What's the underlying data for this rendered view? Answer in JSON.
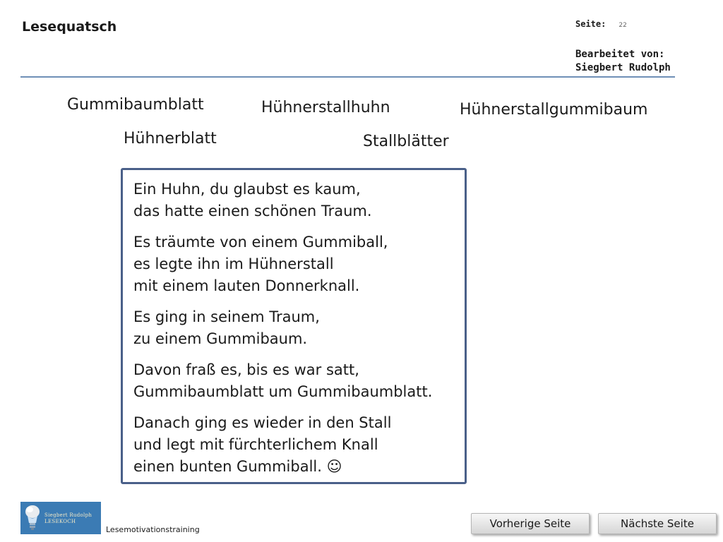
{
  "header": {
    "app_title": "Lesequatsch",
    "page_label": "Seite:",
    "page_number": "22",
    "edited_by_label": "Bearbeitet von:",
    "author": "Siegbert Rudolph"
  },
  "words": [
    "Gummibaumblatt",
    "Hühnerstallhuhn",
    "Hühnerstallgummibaum",
    "Hühnerblatt",
    "Stallblätter"
  ],
  "poem": {
    "stanzas": [
      [
        "Ein Huhn, du glaubst es kaum,",
        "das hatte einen schönen Traum."
      ],
      [
        "Es träumte von einem Gummiball,",
        "es legte ihn im Hühnerstall",
        "mit einem lauten Donnerknall."
      ],
      [
        "Es ging in seinem Traum,",
        "zu einem Gummibaum."
      ],
      [
        "Davon fraß es, bis es war satt,",
        "Gummibaumblatt um Gummibaumblatt."
      ],
      [
        "Danach ging es wieder in den Stall",
        "und legt mit fürchterlichem Knall",
        "einen bunten Gummiball.  ☺"
      ]
    ]
  },
  "footer": {
    "logo_line1": "Siegbert Rudolph",
    "logo_line2": "LESEKOCH",
    "label": "Lesemotivationstraining",
    "prev_button": "Vorherige Seite",
    "next_button": "Nächste Seite"
  },
  "colors": {
    "accent_line": "#6f8fb6",
    "box_border": "#4a6089",
    "logo_background": "#3b7bb4"
  }
}
